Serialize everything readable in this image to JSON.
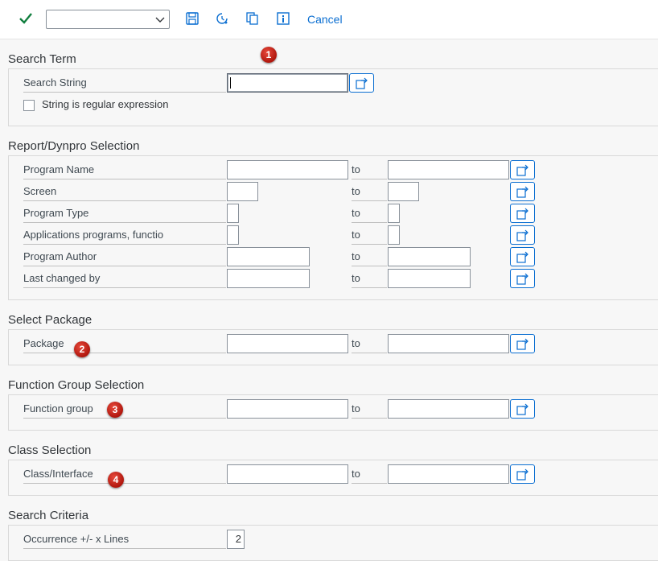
{
  "toolbar": {
    "execute_icon": "checkmark-icon",
    "variant_select_value": "",
    "icons": [
      "save-icon",
      "clock-variant-icon",
      "copy-icon",
      "info-icon"
    ],
    "cancel_label": "Cancel"
  },
  "search_term": {
    "title": "Search Term",
    "search_string_label": "Search String",
    "search_string_value": "",
    "regex_label": "String is regular expression",
    "regex_checked": false
  },
  "report_selection": {
    "title": "Report/Dynpro Selection",
    "to_label": "to",
    "rows": [
      {
        "label": "Program Name"
      },
      {
        "label": "Screen"
      },
      {
        "label": "Program Type"
      },
      {
        "label": "Applications programs, functio"
      },
      {
        "label": "Program Author"
      },
      {
        "label": "Last changed by"
      }
    ]
  },
  "package_selection": {
    "title": "Select Package",
    "label": "Package",
    "to_label": "to"
  },
  "function_group_selection": {
    "title": "Function Group Selection",
    "label": "Function group",
    "to_label": "to"
  },
  "class_selection": {
    "title": "Class Selection",
    "label": "Class/Interface",
    "to_label": "to"
  },
  "search_criteria": {
    "title": "Search Criteria",
    "label": "Occurrence +/- x Lines",
    "value": "2"
  },
  "badges": [
    "1",
    "2",
    "3",
    "4"
  ],
  "colors": {
    "accent": "#0a6ed1",
    "execute_green": "#107e3e",
    "badge_red": "#c81e12",
    "background": "#f7f7f7"
  }
}
